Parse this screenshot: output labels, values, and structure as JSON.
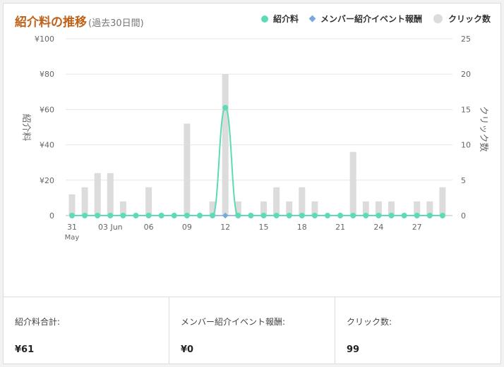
{
  "header": {
    "title": "紹介料の推移",
    "subtitle": "(過去30日間)"
  },
  "legend": {
    "fee": "紹介料",
    "event": "メンバー紹介イベント報酬",
    "clicks": "クリック数"
  },
  "colors": {
    "fee": "#5ddbb7",
    "event": "#7aa7dd",
    "clicks": "#dcdcdc",
    "title": "#c0621a"
  },
  "chart_data": {
    "type": "bar",
    "x_tick_labels": [
      "31",
      "03 Jun",
      "06",
      "09",
      "12",
      "15",
      "18",
      "21",
      "24",
      "27"
    ],
    "x_tick_sublabel": "May",
    "left_axis": {
      "label": "紹介料",
      "ylim": [
        0,
        100
      ],
      "ticks": [
        "¥100",
        "¥80",
        "¥60",
        "¥40",
        "¥20",
        "0"
      ]
    },
    "right_axis": {
      "label": "クリック数",
      "ylim": [
        0,
        25
      ],
      "ticks": [
        "25",
        "20",
        "15",
        "10",
        "5",
        "0"
      ]
    },
    "grid": true,
    "legend_position": "top-right",
    "series": [
      {
        "name": "紹介料",
        "type": "line",
        "axis": "left",
        "values": [
          0,
          0,
          0,
          0,
          0,
          0,
          0,
          0,
          0,
          0,
          0,
          0,
          61,
          0,
          0,
          0,
          0,
          0,
          0,
          0,
          0,
          0,
          0,
          0,
          0,
          0,
          0,
          0,
          0,
          0
        ]
      },
      {
        "name": "メンバー紹介イベント報酬",
        "type": "line",
        "axis": "left",
        "values": [
          0,
          0,
          0,
          0,
          0,
          0,
          0,
          0,
          0,
          0,
          0,
          0,
          0,
          0,
          0,
          0,
          0,
          0,
          0,
          0,
          0,
          0,
          0,
          0,
          0,
          0,
          0,
          0,
          0,
          0
        ]
      },
      {
        "name": "クリック数",
        "type": "bar",
        "axis": "right",
        "values": [
          3,
          4,
          6,
          6,
          2,
          0,
          4,
          0,
          0,
          13,
          0,
          2,
          20,
          2,
          0,
          2,
          4,
          2,
          4,
          2,
          0,
          0,
          9,
          2,
          2,
          2,
          0,
          2,
          2,
          4
        ]
      }
    ]
  },
  "stats": [
    {
      "label": "紹介料合計:",
      "value": "¥61"
    },
    {
      "label": "メンバー紹介イベント報酬:",
      "value": "¥0"
    },
    {
      "label": "クリック数:",
      "value": "99"
    }
  ]
}
